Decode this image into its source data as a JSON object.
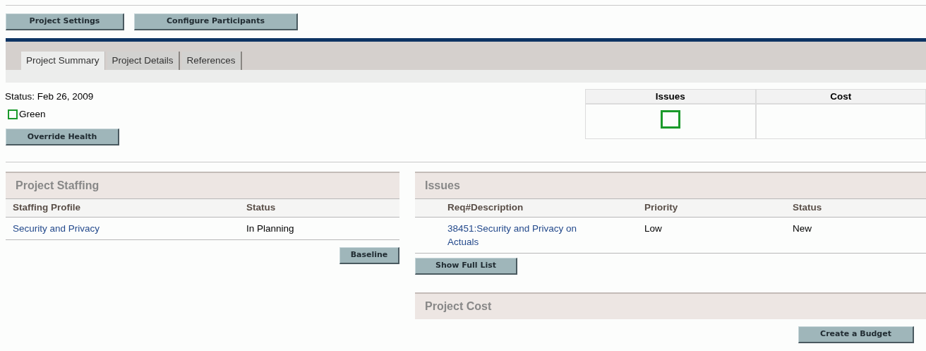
{
  "top_buttons": [
    "Project Settings",
    "Configure Participants"
  ],
  "tabs": [
    {
      "label": "Project Summary",
      "selected": true
    },
    {
      "label": "Project Details",
      "selected": false
    },
    {
      "label": "References",
      "selected": false
    }
  ],
  "status": {
    "text": "Status: Feb 26, 2009",
    "health": "Green",
    "button": "Override Health"
  },
  "health_table": {
    "columns": [
      {
        "title": "Issues",
        "indicator": true
      },
      {
        "title": "Cost",
        "indicator": false
      }
    ]
  },
  "staffing": {
    "title": "Project Staffing",
    "columns": [
      "Staffing Profile",
      "Status"
    ],
    "rows": [
      [
        "Security and Privacy",
        "In Planning"
      ]
    ],
    "button": "Baseline"
  },
  "issues": {
    "title": "Issues",
    "columns": [
      "Req#Description",
      "Priority",
      "Status"
    ],
    "rows": [
      [
        "38451:Security and Privacy on Actuals",
        "Low",
        "New"
      ]
    ],
    "button": "Show Full List"
  },
  "cost": {
    "title": "Project Cost",
    "button": "Create a Budget"
  }
}
